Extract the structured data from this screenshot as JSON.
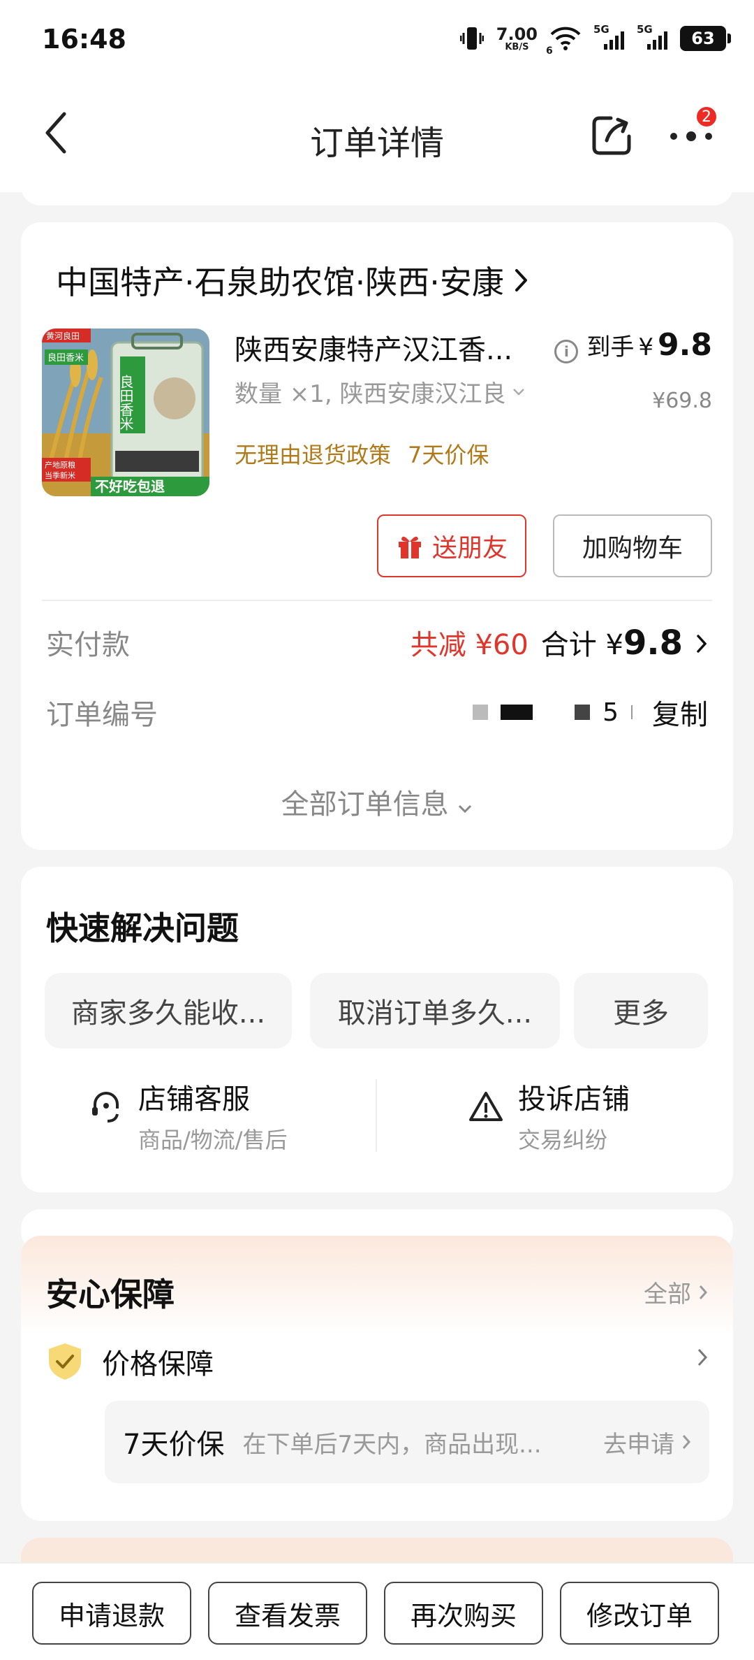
{
  "status_bar": {
    "time": "16:48",
    "net_speed_value": "7.00",
    "net_speed_unit": "KB/S",
    "wifi_tag": "6",
    "sim1_tag": "5G",
    "sim2_tag": "5G",
    "battery": "63"
  },
  "nav": {
    "title": "订单详情",
    "badge_count": "2"
  },
  "order": {
    "shop_name": "中国特产·石泉助农馆·陕西·安康",
    "product_name": "陕西安康特产汉江香...",
    "spec": "数量 ×1, 陕西安康汉江良",
    "policy_return": "无理由退货政策",
    "policy_price": "7天价保",
    "price_label": "到手",
    "price_currency": "¥",
    "price_value": "9.8",
    "original_price": "¥69.8",
    "gift_button": "送朋友",
    "cart_button": "加购物车",
    "paid_label": "实付款",
    "discount_text": "共减 ¥60",
    "total_label": "合计",
    "total_currency": "¥",
    "total_value": "9.8",
    "order_no_label": "订单编号",
    "order_no_fragment": "5",
    "copy_button": "复制",
    "all_info": "全部订单信息",
    "thumb_text": {
      "top_tag": "黄河良田",
      "sub_tag": "良田香米",
      "bag_title": "良田香米",
      "origin": "产地原粮",
      "season": "当季新米",
      "slogan": "不好吃包退"
    }
  },
  "quick": {
    "title": "快速解决问题",
    "chips": [
      "商家多久能收...",
      "取消订单多久...",
      "更多"
    ],
    "service_title": "店铺客服",
    "service_sub": "商品/物流/售后",
    "complain_title": "投诉店铺",
    "complain_sub": "交易纠纷"
  },
  "guarantee": {
    "title": "安心保障",
    "all": "全部",
    "item": "价格保障",
    "box_title": "7天价保",
    "box_desc": "在下单后7天内，商品出现...",
    "box_action": "去申请"
  },
  "bottom_actions": [
    "申请退款",
    "查看发票",
    "再次购买",
    "修改订单"
  ],
  "colors": {
    "accent_red": "#e0352b",
    "policy_gold": "#b07a1a",
    "badge_red": "#ee2a24"
  }
}
